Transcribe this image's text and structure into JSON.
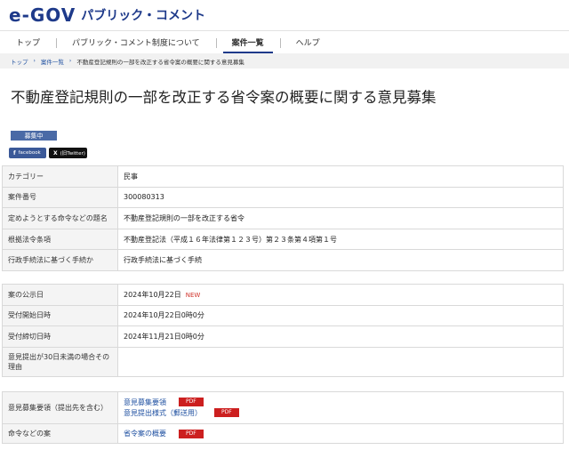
{
  "header": {
    "logo_text": "e-GOV",
    "site_name": "パブリック・コメント"
  },
  "nav": {
    "items": [
      {
        "label": "トップ"
      },
      {
        "label": "パブリック・コメント制度について"
      },
      {
        "label": "案件一覧"
      },
      {
        "label": "ヘルプ"
      }
    ],
    "active_index": 2
  },
  "breadcrumb": {
    "items": [
      "トップ",
      "案件一覧"
    ],
    "separator": "›",
    "current": "不動産登記規則の一部を改正する省令案の概要に関する意見募集"
  },
  "page": {
    "title": "不動産登記規則の一部を改正する省令案の概要に関する意見募集",
    "status": "募集中",
    "share": {
      "facebook": "facebook",
      "x": "(旧Twitter)",
      "x_icon": "X"
    }
  },
  "details": {
    "rows": [
      {
        "label": "カテゴリー",
        "value": "民事"
      },
      {
        "label": "案件番号",
        "value": "300080313"
      },
      {
        "label": "定めようとする命令などの題名",
        "value": "不動産登記規則の一部を改正する省令"
      },
      {
        "label": "根拠法令条項",
        "value": "不動産登記法（平成１６年法律第１２３号）第２３条第４項第１号"
      },
      {
        "label": "行政手続法に基づく手続か",
        "value": "行政手続法に基づく手続"
      }
    ]
  },
  "dates": {
    "publish_label": "案の公示日",
    "publish_value": "2024年10月22日",
    "new_tag": "NEW",
    "start_label": "受付開始日時",
    "start_value": "2024年10月22日0時0分",
    "end_label": "受付締切日時",
    "end_value": "2024年11月21日0時0分",
    "reason_label": "意見提出が30日未満の場合その理由",
    "reason_value": ""
  },
  "documents": {
    "guidelines_label": "意見募集要領（提出先を含む）",
    "guidelines_links": [
      {
        "text": "意見募集要領",
        "tag": "PDF"
      },
      {
        "text": "意見提出様式（郵送用）",
        "tag": "PDF"
      }
    ],
    "draft_label": "命令などの案",
    "draft_links": [
      {
        "text": "省令案の概要",
        "tag": "PDF"
      }
    ]
  },
  "colors": {
    "brand": "#1e3a8a",
    "link": "#1e4fa0",
    "status_badge": "#4a6aa6",
    "pdf_tag": "#cc1f1f",
    "new_tag": "#d0342c"
  }
}
